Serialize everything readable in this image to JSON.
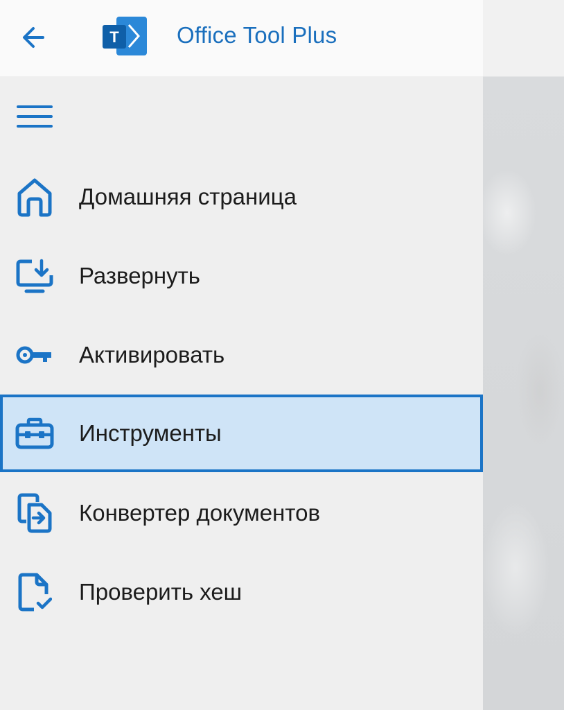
{
  "app": {
    "title": "Office Tool Plus",
    "logo_letter": "T"
  },
  "titlebar": {
    "back_icon": "arrow-left-icon"
  },
  "nav": {
    "menu_icon": "hamburger-menu-icon",
    "items": [
      {
        "label": "Домашняя страница",
        "icon": "home-icon",
        "selected": false
      },
      {
        "label": "Развернуть",
        "icon": "monitor-download-icon",
        "selected": false
      },
      {
        "label": "Активировать",
        "icon": "key-icon",
        "selected": false
      },
      {
        "label": "Инструменты",
        "icon": "toolbox-icon",
        "selected": true
      },
      {
        "label": "Конвертер документов",
        "icon": "document-convert-icon",
        "selected": false
      },
      {
        "label": "Проверить хеш",
        "icon": "document-check-icon",
        "selected": false
      }
    ]
  },
  "colors": {
    "accent": "#1b74c6",
    "selected_background": "#cfe4f7",
    "title_text": "#1a6fbd",
    "pane_background": "#efefef"
  }
}
